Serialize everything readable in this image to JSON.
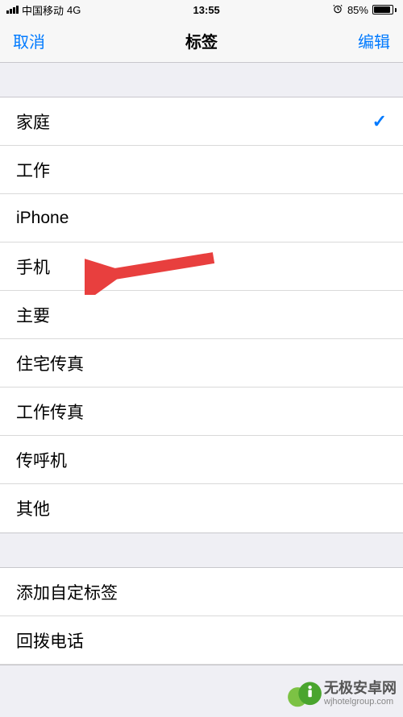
{
  "status": {
    "carrier": "中国移动",
    "network": "4G",
    "time": "13:55",
    "batteryPct": "85%"
  },
  "nav": {
    "left": "取消",
    "title": "标签",
    "right": "编辑"
  },
  "labels": [
    {
      "text": "家庭",
      "selected": true
    },
    {
      "text": "工作",
      "selected": false
    },
    {
      "text": "iPhone",
      "selected": false
    },
    {
      "text": "手机",
      "selected": false
    },
    {
      "text": "主要",
      "selected": false
    },
    {
      "text": "住宅传真",
      "selected": false
    },
    {
      "text": "工作传真",
      "selected": false
    },
    {
      "text": "传呼机",
      "selected": false
    },
    {
      "text": "其他",
      "selected": false
    }
  ],
  "extra": [
    {
      "text": "添加自定标签"
    },
    {
      "text": "回拨电话"
    }
  ],
  "watermark": {
    "cn": "无极安卓网",
    "en": "wjhotelgroup.com"
  },
  "annotation": {
    "arrow_target": "手机"
  }
}
